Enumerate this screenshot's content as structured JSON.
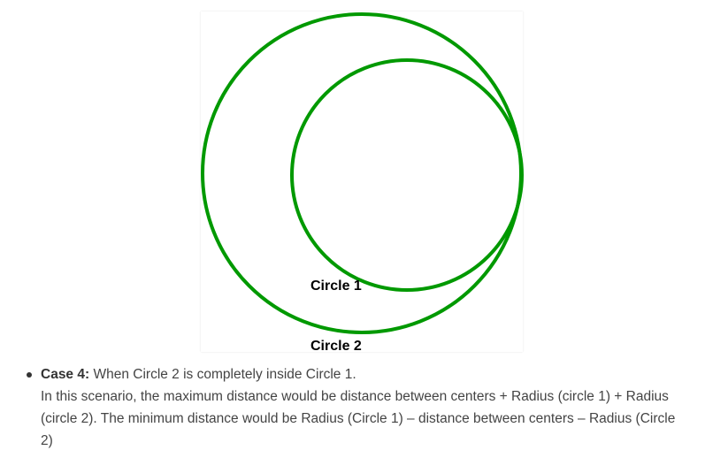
{
  "diagram": {
    "circle_color": "#009900",
    "label_circle_1": "Circle 1",
    "label_circle_2": "Circle 2"
  },
  "content": {
    "case_heading": "Case 4:",
    "case_description": "When Circle 2 is completely inside Circle 1.",
    "case_body": "In this scenario, the maximum distance would be distance between centers + Radius (circle 1) + Radius (circle 2). The minimum distance would be Radius (Circle 1) – distance between centers – Radius (Circle 2)"
  }
}
